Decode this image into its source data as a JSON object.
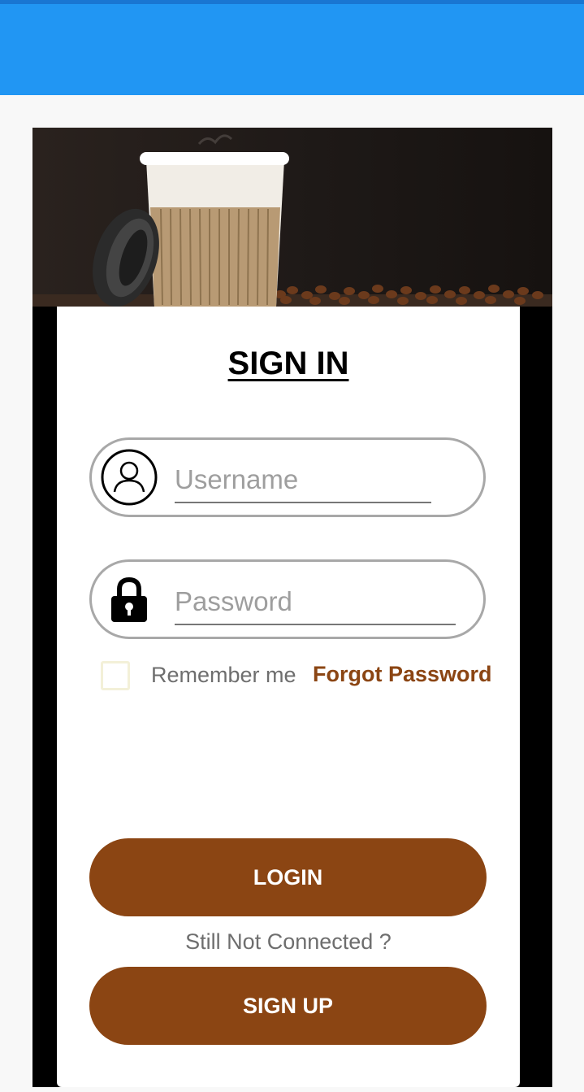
{
  "form": {
    "title": "SIGN IN",
    "username": {
      "placeholder": "Username",
      "value": "",
      "icon": "user-icon"
    },
    "password": {
      "placeholder": "Password",
      "value": "",
      "icon": "lock-icon"
    },
    "remember_label": "Remember me",
    "forgot_label": "Forgot Password",
    "login_label": "LOGIN",
    "still_text": "Still Not Connected ?",
    "signup_label": "SIGN UP"
  },
  "colors": {
    "app_bar": "#2196f3",
    "accent_brown": "#8b4513",
    "frame": "#000000"
  }
}
